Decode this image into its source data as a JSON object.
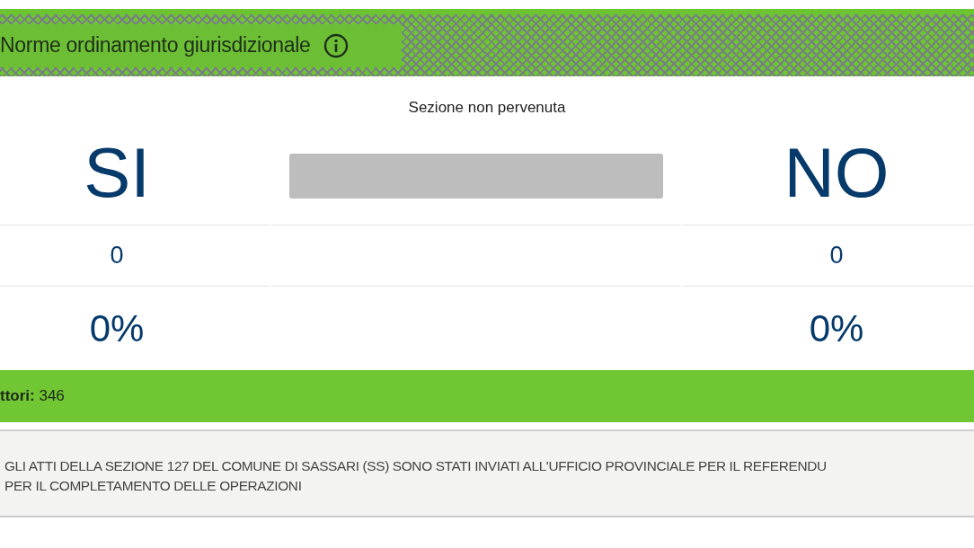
{
  "header": {
    "title": "Norme ordinamento giurisdizionale"
  },
  "section_status": "Sezione non pervenuta",
  "results": [
    {
      "kind": "yes",
      "label": "SI",
      "votes": "0",
      "percent": "0%"
    },
    {
      "kind": "no",
      "label": "NO",
      "votes": "0",
      "percent": "0%"
    }
  ],
  "voters_bar": {
    "text": "**ttori:** 346"
  },
  "notice": {
    "lines": [
      "GLI ATTI DELLA SEZIONE 127 DEL COMUNE DI SASSARI (SS) SONO STATI INVIATI ALL'UFFICIO PROVINCIALE PER IL REFERENDU",
      "PER IL COMPLETAMENTO DELLE OPERAZIONI"
    ]
  }
}
